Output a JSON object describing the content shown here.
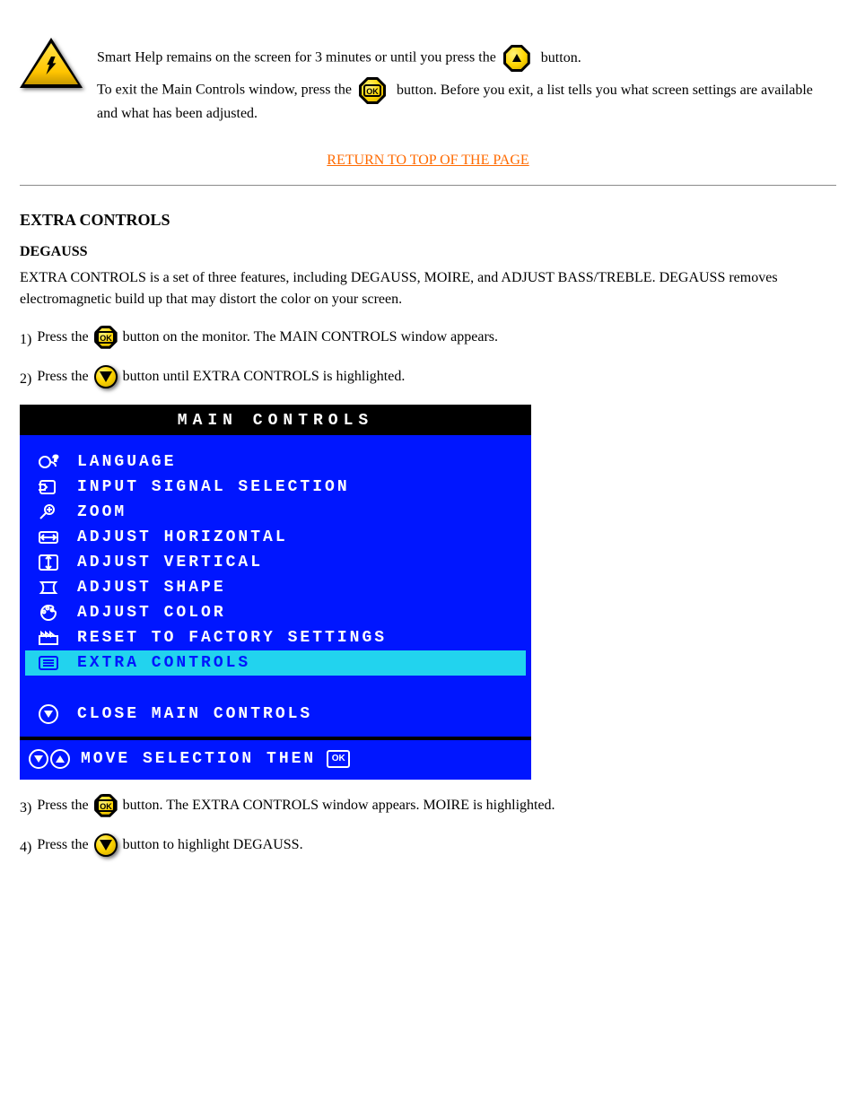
{
  "warning": {
    "p1_a": "Smart Help remains on the screen for 3 minutes or until you press the",
    "p1_b": "button.",
    "p2_a": "To exit the Main Controls window, press the",
    "p2_b": "button. Before you exit, a list tells you what screen settings are available and what has been adjusted."
  },
  "return_link": "RETURN TO TOP OF THE PAGE",
  "extra": {
    "heading": "EXTRA CONTROLS",
    "subhead": "DEGAUSS",
    "intro": "EXTRA CONTROLS is a set of three features, including DEGAUSS, MOIRE, and ADJUST BASS/TREBLE. DEGAUSS removes electromagnetic build up that may distort the color on your screen.",
    "step1_a": "Press the",
    "step1_b": "button on the monitor. The MAIN CONTROLS window appears.",
    "step2_a": "Press the",
    "step2_b": "button until EXTRA CONTROLS is highlighted.",
    "step3_a": "Press the",
    "step3_b": "button. The EXTRA CONTROLS window appears. MOIRE is highlighted.",
    "step4_a": "Press the",
    "step4_b": "button to highlight DEGAUSS."
  },
  "osd": {
    "title": "MAIN CONTROLS",
    "items": [
      "LANGUAGE",
      "INPUT SIGNAL SELECTION",
      "ZOOM",
      "ADJUST HORIZONTAL",
      "ADJUST VERTICAL",
      "ADJUST SHAPE",
      "ADJUST COLOR",
      "RESET TO FACTORY SETTINGS",
      "EXTRA CONTROLS"
    ],
    "highlight_index": 8,
    "close": "CLOSE MAIN CONTROLS",
    "footer_a": "MOVE SELECTION THEN",
    "ok": "OK"
  },
  "icons": {
    "ok_button": "OK",
    "up_button": "up-arrow",
    "down_button": "down-arrow",
    "warning_triangle": "warning"
  }
}
